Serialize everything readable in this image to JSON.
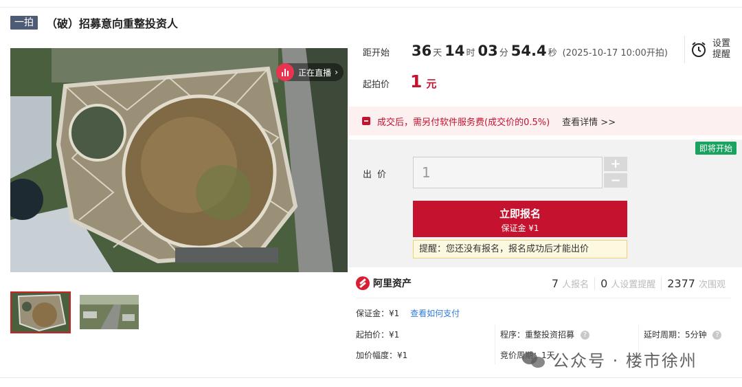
{
  "header": {
    "tag": "一拍",
    "title": "（破）招募意向重整投资人"
  },
  "live": {
    "label": "正在直播"
  },
  "countdown": {
    "label": "距开始",
    "days": "36",
    "days_unit": "天",
    "hours": "14",
    "hours_unit": "时",
    "minutes": "03",
    "minutes_unit": "分",
    "seconds": "54.4",
    "seconds_unit": "秒",
    "start_time": "(2025-10-17 10:00开拍)"
  },
  "remind": {
    "label": "设置提醒"
  },
  "start_price": {
    "label": "起拍价",
    "value": "1",
    "unit": "元"
  },
  "notice": {
    "text": "成交后，需另付软件服务费(成交价的0.5%)",
    "link": "查看详情 >>"
  },
  "bid": {
    "badge": "即将开始",
    "label": "出价",
    "input_placeholder": "1",
    "plus": "+",
    "minus": "−",
    "register_label": "立即报名",
    "deposit_label": "保证金 ¥1",
    "tip": "提醒：您还没有报名，报名成功后才能出价"
  },
  "platform": {
    "name": "阿里资产"
  },
  "stats": [
    {
      "value": "7",
      "label": "人报名"
    },
    {
      "value": "0",
      "label": "人设置提醒"
    },
    {
      "value": "2377",
      "label": "次围观"
    }
  ],
  "details": {
    "deposit": "保证金：¥1",
    "deposit_link": "查看如何支付",
    "start_price": "起拍价：¥1",
    "increment": "加价幅度：¥1",
    "procedure": "程序：重整投资招募",
    "bid_cycle": "竞价周期：1天",
    "delay": "延时周期：5分钟"
  },
  "watermark": {
    "text": "公众号 · 楼市徐州"
  },
  "colors": {
    "accent": "#c4122f",
    "tag_bg": "#4e5b77",
    "soon_badge": "#1aa260",
    "link": "#2d7bd8"
  }
}
